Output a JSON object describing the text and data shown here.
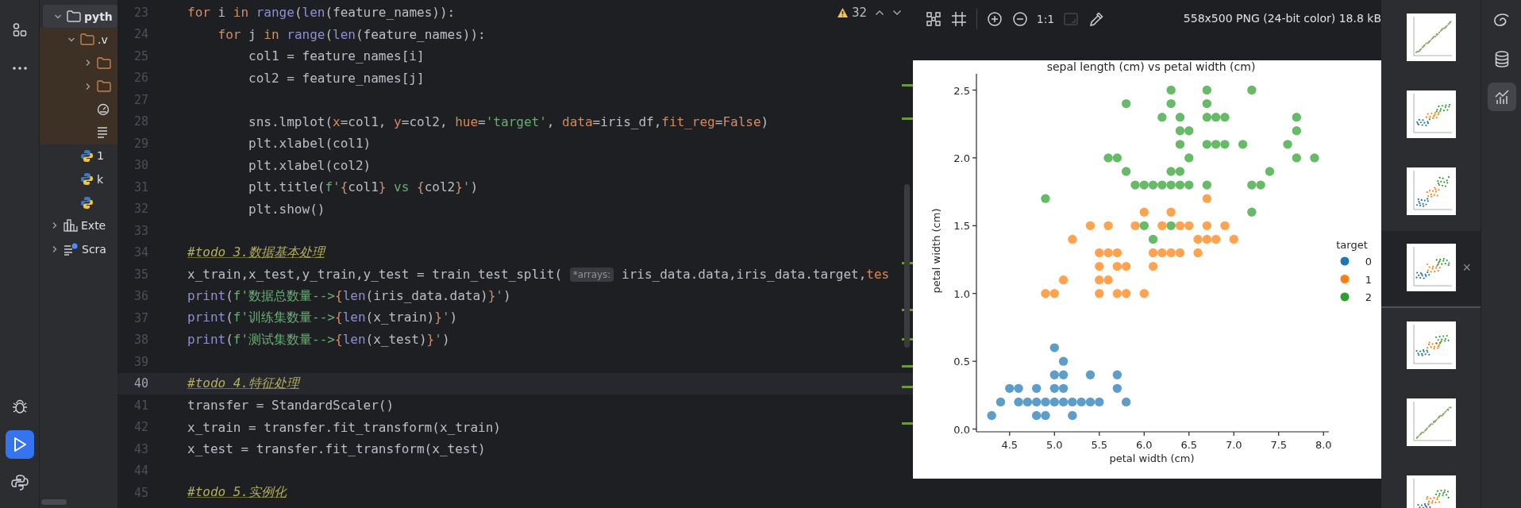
{
  "left_toolbar": {
    "top": [
      {
        "kind": "structure",
        "selected": false
      },
      {
        "kind": "more",
        "selected": false
      }
    ],
    "bottom": [
      {
        "kind": "debug",
        "selected": false
      },
      {
        "kind": "run",
        "selected": true
      },
      {
        "kind": "python-console",
        "selected": false
      }
    ]
  },
  "project_tree": [
    {
      "label": "pyth",
      "kind": "folder",
      "expanded": true,
      "selected": true,
      "children": [
        {
          "label": ".v",
          "kind": "folder",
          "expanded": true,
          "excluded": true,
          "selected": false,
          "children": [
            {
              "kind": "folder",
              "expanded": false,
              "selected": false
            },
            {
              "kind": "folder",
              "expanded": false,
              "selected": false
            },
            {
              "kind": "config",
              "selected": false
            },
            {
              "kind": "text",
              "selected": false
            }
          ]
        },
        {
          "label": "1",
          "kind": "python",
          "selected": false
        },
        {
          "label": "k",
          "kind": "python",
          "selected": false
        },
        {
          "kind": "python",
          "selected": false
        }
      ]
    },
    {
      "label": "Exte",
      "kind": "library",
      "expanded": false,
      "selected": false
    },
    {
      "label": "Scra",
      "kind": "scratch",
      "expanded": false,
      "selected": false
    }
  ],
  "editor": {
    "warnings": "32",
    "lines": [
      {
        "n": "23",
        "current": false,
        "tokens": [
          {
            "kind": "keyword",
            "text": "for"
          },
          {
            "kind": "plain",
            "text": " i "
          },
          {
            "kind": "keyword",
            "text": "in "
          },
          {
            "kind": "builtin",
            "text": "range"
          },
          {
            "kind": "plain",
            "text": "("
          },
          {
            "kind": "builtin",
            "text": "len"
          },
          {
            "kind": "plain",
            "text": "(feature_names)):"
          }
        ]
      },
      {
        "n": "24",
        "current": false,
        "tokens": [
          {
            "kind": "keyword",
            "text": "    for"
          },
          {
            "kind": "plain",
            "text": " j "
          },
          {
            "kind": "keyword",
            "text": "in "
          },
          {
            "kind": "builtin",
            "text": "range"
          },
          {
            "kind": "plain",
            "text": "("
          },
          {
            "kind": "builtin",
            "text": "len"
          },
          {
            "kind": "plain",
            "text": "(feature_names)):"
          }
        ]
      },
      {
        "n": "25",
        "current": false,
        "tokens": [
          {
            "kind": "plain",
            "text": "        col1 = feature_names[i]"
          }
        ]
      },
      {
        "n": "26",
        "current": false,
        "tokens": [
          {
            "kind": "plain",
            "text": "        col2 = feature_names[j]"
          }
        ]
      },
      {
        "n": "27",
        "current": false
      },
      {
        "n": "28",
        "current": false,
        "tokens": [
          {
            "kind": "plain",
            "text": "        sns.lmplot("
          },
          {
            "kind": "param",
            "text": "x"
          },
          {
            "kind": "plain",
            "text": "=col1, "
          },
          {
            "kind": "param",
            "text": "y"
          },
          {
            "kind": "plain",
            "text": "=col2, "
          },
          {
            "kind": "param",
            "text": "hue"
          },
          {
            "kind": "plain",
            "text": "="
          },
          {
            "kind": "string",
            "text": "'target'"
          },
          {
            "kind": "plain",
            "text": ", "
          },
          {
            "kind": "param",
            "text": "data"
          },
          {
            "kind": "plain",
            "text": "=iris_df,"
          },
          {
            "kind": "param",
            "text": "fit_reg"
          },
          {
            "kind": "plain",
            "text": "="
          },
          {
            "kind": "keyword",
            "text": "False"
          },
          {
            "kind": "plain",
            "text": ")"
          }
        ]
      },
      {
        "n": "29",
        "current": false,
        "tokens": [
          {
            "kind": "plain",
            "text": "        plt.xlabel(col1)"
          }
        ]
      },
      {
        "n": "30",
        "current": false,
        "tokens": [
          {
            "kind": "plain",
            "text": "        plt.xlabel(col2)"
          }
        ]
      },
      {
        "n": "31",
        "current": false,
        "tokens": [
          {
            "kind": "plain",
            "text": "        plt.title("
          },
          {
            "kind": "string",
            "text": "f'"
          },
          {
            "kind": "brace",
            "text": "{"
          },
          {
            "kind": "plain",
            "text": "col1"
          },
          {
            "kind": "brace",
            "text": "}"
          },
          {
            "kind": "string",
            "text": " vs "
          },
          {
            "kind": "brace",
            "text": "{"
          },
          {
            "kind": "plain",
            "text": "col2"
          },
          {
            "kind": "brace",
            "text": "}"
          },
          {
            "kind": "string",
            "text": "'"
          },
          {
            "kind": "plain",
            "text": ")"
          }
        ]
      },
      {
        "n": "32",
        "current": false,
        "tokens": [
          {
            "kind": "plain",
            "text": "        plt.show()"
          }
        ]
      },
      {
        "n": "33",
        "current": false
      },
      {
        "n": "34",
        "current": false,
        "tokens": [
          {
            "kind": "todo",
            "text": "#todo 3.数据基本处理"
          }
        ]
      },
      {
        "n": "35",
        "current": false,
        "tokens": [
          {
            "kind": "plain",
            "text": "x_train,x_test,y_train,y_test = train_test_split( "
          },
          {
            "kind": "hint",
            "text": "*arrays:"
          },
          {
            "kind": "plain",
            "text": " iris_data.data,iris_data.target,"
          },
          {
            "kind": "param",
            "text": "tes"
          }
        ]
      },
      {
        "n": "36",
        "current": false,
        "tokens": [
          {
            "kind": "builtin",
            "text": "print"
          },
          {
            "kind": "plain",
            "text": "("
          },
          {
            "kind": "string",
            "text": "f'数据总数量-->"
          },
          {
            "kind": "brace",
            "text": "{"
          },
          {
            "kind": "builtin",
            "text": "len"
          },
          {
            "kind": "plain",
            "text": "(iris_data.data)"
          },
          {
            "kind": "brace",
            "text": "}"
          },
          {
            "kind": "string",
            "text": "'"
          },
          {
            "kind": "plain",
            "text": ")"
          }
        ]
      },
      {
        "n": "37",
        "current": false,
        "tokens": [
          {
            "kind": "builtin",
            "text": "print"
          },
          {
            "kind": "plain",
            "text": "("
          },
          {
            "kind": "string",
            "text": "f'训练集数量-->"
          },
          {
            "kind": "brace",
            "text": "{"
          },
          {
            "kind": "builtin",
            "text": "len"
          },
          {
            "kind": "plain",
            "text": "(x_train)"
          },
          {
            "kind": "brace",
            "text": "}"
          },
          {
            "kind": "string",
            "text": "'"
          },
          {
            "kind": "plain",
            "text": ")"
          }
        ]
      },
      {
        "n": "38",
        "current": false,
        "tokens": [
          {
            "kind": "builtin",
            "text": "print"
          },
          {
            "kind": "plain",
            "text": "("
          },
          {
            "kind": "string",
            "text": "f'测试集数量-->"
          },
          {
            "kind": "brace",
            "text": "{"
          },
          {
            "kind": "builtin",
            "text": "len"
          },
          {
            "kind": "plain",
            "text": "(x_test)"
          },
          {
            "kind": "brace",
            "text": "}"
          },
          {
            "kind": "string",
            "text": "'"
          },
          {
            "kind": "plain",
            "text": ")"
          }
        ]
      },
      {
        "n": "39",
        "current": false
      },
      {
        "n": "40",
        "current": true,
        "tokens": [
          {
            "kind": "todo",
            "text": "#todo 4.特征处理"
          }
        ]
      },
      {
        "n": "41",
        "current": false,
        "tokens": [
          {
            "kind": "plain",
            "text": "transfer = StandardScaler()"
          }
        ]
      },
      {
        "n": "42",
        "current": false,
        "tokens": [
          {
            "kind": "plain",
            "text": "x_train = transfer.fit_transform(x_train)"
          }
        ]
      },
      {
        "n": "43",
        "current": false,
        "tokens": [
          {
            "kind": "plain",
            "text": "x_test = transfer.fit_transform(x_test)"
          }
        ]
      },
      {
        "n": "44",
        "current": false
      },
      {
        "n": "45",
        "current": false,
        "tokens": [
          {
            "kind": "todo",
            "text": "#todo 5.实例化"
          }
        ]
      }
    ]
  },
  "viewer": {
    "toolbar": [
      {
        "kind": "fit",
        "disabled": false
      },
      {
        "kind": "grid",
        "disabled": false
      },
      {
        "kind": "separator"
      },
      {
        "kind": "zoom-in",
        "disabled": false
      },
      {
        "kind": "zoom-out",
        "disabled": false
      },
      {
        "kind": "actual-size",
        "label": "1:1",
        "disabled": false
      },
      {
        "kind": "frame",
        "disabled": true
      },
      {
        "kind": "color-picker",
        "disabled": false
      }
    ],
    "image_info": "558x500 PNG (24-bit color) 18.8 kB",
    "chart_data": {
      "type": "scatter",
      "title": "sepal length (cm) vs petal width (cm)",
      "xlabel": "petal width (cm)",
      "ylabel": "petal width (cm)",
      "legend": {
        "title": "target"
      },
      "xlim": [
        4.13,
        8.06
      ],
      "ylim": [
        -0.02,
        2.62
      ],
      "xticks": [
        {
          "value": 4.5,
          "label": "4.5"
        },
        {
          "value": 5,
          "label": "5.0"
        },
        {
          "value": 5.5,
          "label": "5.5"
        },
        {
          "value": 6,
          "label": "6.0"
        },
        {
          "value": 6.5,
          "label": "6.5"
        },
        {
          "value": 7,
          "label": "7.0"
        },
        {
          "value": 7.5,
          "label": "7.5"
        },
        {
          "value": 8,
          "label": "8.0"
        }
      ],
      "yticks": [
        {
          "value": 0,
          "label": "0.0"
        },
        {
          "value": 0.5,
          "label": "0.5"
        },
        {
          "value": 1,
          "label": "1.0"
        },
        {
          "value": 1.5,
          "label": "1.5"
        },
        {
          "value": 2,
          "label": "2.0"
        },
        {
          "value": 2.5,
          "label": "2.5"
        }
      ],
      "series": [
        {
          "name": "0",
          "color": "#1f77b4",
          "x": [
            5.1,
            4.9,
            4.7,
            4.6,
            5.0,
            5.4,
            4.6,
            4.4,
            4.9,
            5.4,
            4.8,
            4.8,
            4.3,
            5.8,
            5.7,
            5.1,
            5.7,
            5.1,
            5.1,
            5.0,
            5.2,
            5.2,
            5.5,
            5.0,
            4.5,
            5.0,
            4.8,
            5.3
          ],
          "values": [
            0.2,
            0.2,
            0.2,
            0.2,
            0.2,
            0.4,
            0.3,
            0.2,
            0.1,
            0.2,
            0.2,
            0.1,
            0.1,
            0.2,
            0.4,
            0.3,
            0.3,
            0.4,
            0.5,
            0.4,
            0.2,
            0.1,
            0.2,
            0.3,
            0.3,
            0.6,
            0.3,
            0.2
          ]
        },
        {
          "name": "1",
          "color": "#ff7f0e",
          "x": [
            7.0,
            6.4,
            6.9,
            5.5,
            6.5,
            5.7,
            6.3,
            4.9,
            6.6,
            5.2,
            5.0,
            5.9,
            6.0,
            5.6,
            6.7,
            5.6,
            5.8,
            6.2,
            5.6,
            6.1,
            6.1,
            6.4,
            6.6,
            6.8,
            6.7,
            5.7,
            5.5,
            5.5,
            5.8,
            6.0,
            5.4,
            6.7,
            6.3,
            5.5,
            5.7,
            6.2,
            5.1
          ],
          "values": [
            1.4,
            1.5,
            1.5,
            1.3,
            1.5,
            1.3,
            1.6,
            1.0,
            1.3,
            1.4,
            1.0,
            1.5,
            1.0,
            1.3,
            1.4,
            1.5,
            1.0,
            1.5,
            1.1,
            1.3,
            1.2,
            1.3,
            1.4,
            1.4,
            1.7,
            1.0,
            1.1,
            1.0,
            1.2,
            1.6,
            1.5,
            1.5,
            1.3,
            1.2,
            1.2,
            1.3,
            1.1
          ]
        },
        {
          "name": "2",
          "color": "#2ca02c",
          "x": [
            6.3,
            5.8,
            7.1,
            6.3,
            6.5,
            7.6,
            4.9,
            7.3,
            6.7,
            7.2,
            6.5,
            6.4,
            6.8,
            5.7,
            5.8,
            6.4,
            6.5,
            7.7,
            7.7,
            6.0,
            6.9,
            5.6,
            7.7,
            6.7,
            7.2,
            6.2,
            6.1,
            6.4,
            7.2,
            7.4,
            7.9,
            6.4,
            6.3,
            6.1,
            6.3,
            6.4,
            6.0,
            6.9,
            6.7,
            6.8,
            6.7,
            6.7,
            6.3,
            6.2,
            5.9
          ],
          "values": [
            2.5,
            1.9,
            2.1,
            1.8,
            2.2,
            2.1,
            1.7,
            1.8,
            1.8,
            2.5,
            2.0,
            1.9,
            2.1,
            2.0,
            2.4,
            2.3,
            1.8,
            2.2,
            2.3,
            1.5,
            2.3,
            2.0,
            2.0,
            2.1,
            1.8,
            1.8,
            1.8,
            2.1,
            1.6,
            1.9,
            2.0,
            2.2,
            1.5,
            1.4,
            2.4,
            1.8,
            1.8,
            2.1,
            2.4,
            2.3,
            2.5,
            2.3,
            1.9,
            2.3,
            1.8
          ]
        }
      ]
    }
  },
  "thumbnails": [
    {
      "kind": "line",
      "selected": false
    },
    {
      "kind": "scatter",
      "selected": false
    },
    {
      "kind": "rising",
      "selected": false
    },
    {
      "kind": "scatter",
      "selected": true,
      "close": "×"
    },
    {
      "kind": "scatter",
      "selected": false
    },
    {
      "kind": "line",
      "selected": false
    },
    {
      "kind": "scatter",
      "selected": false
    }
  ],
  "right_toolbar": [
    {
      "kind": "spiral",
      "selected": false
    },
    {
      "kind": "database",
      "selected": false
    },
    {
      "kind": "plots",
      "selected": true
    }
  ]
}
